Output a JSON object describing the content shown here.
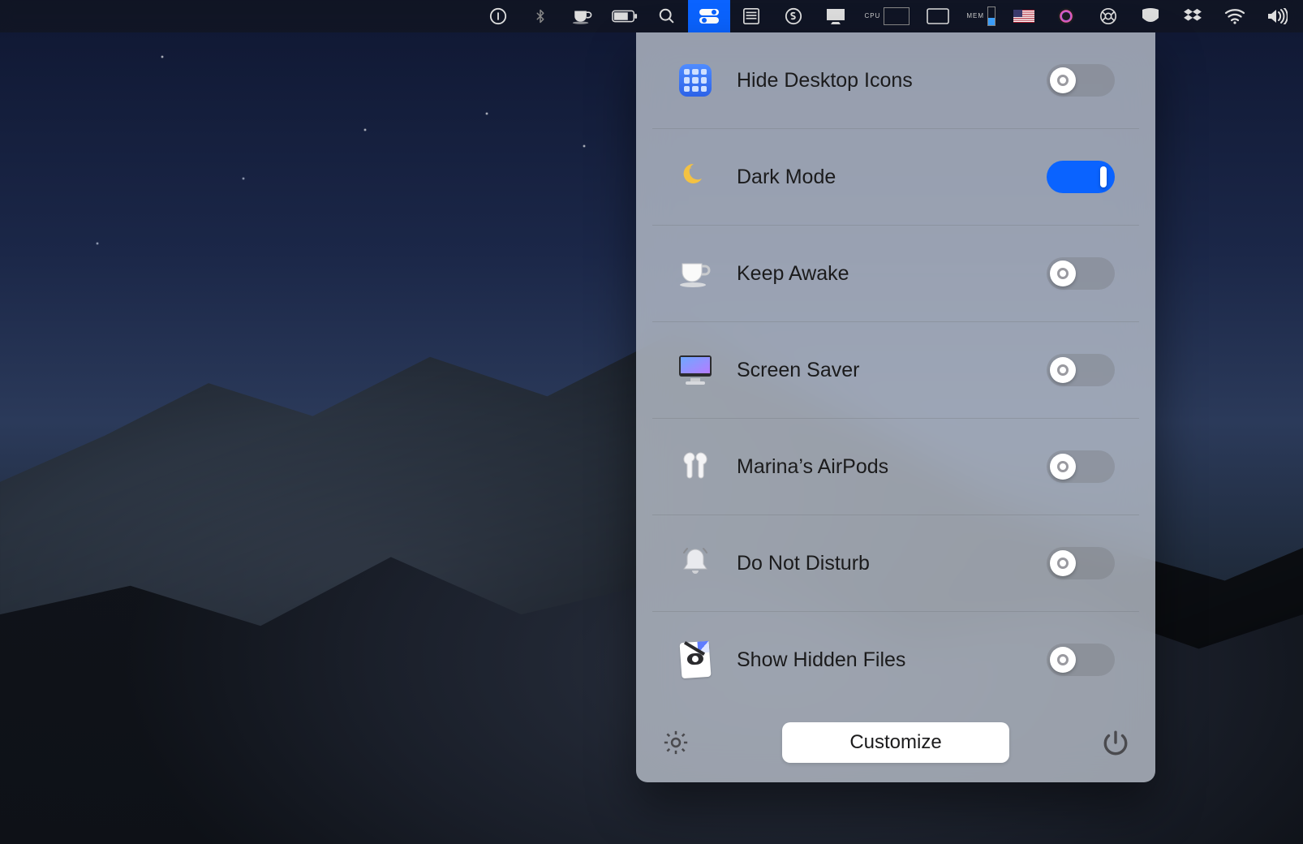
{
  "menubar": {
    "items": [
      {
        "name": "onepassword-icon"
      },
      {
        "name": "bluetooth-icon"
      },
      {
        "name": "caffeine-icon"
      },
      {
        "name": "battery-icon"
      },
      {
        "name": "spotlight-icon"
      },
      {
        "name": "control-center-icon",
        "selected": true
      },
      {
        "name": "disk-icon"
      },
      {
        "name": "skype-icon"
      },
      {
        "name": "display-icon"
      },
      {
        "name": "cpu-monitor-icon",
        "label": "CPU"
      },
      {
        "name": "activity-icon"
      },
      {
        "name": "memory-monitor-icon",
        "label": "MEM"
      },
      {
        "name": "input-source-us-icon"
      },
      {
        "name": "siri-icon"
      },
      {
        "name": "camera-settings-icon"
      },
      {
        "name": "vpn-icon"
      },
      {
        "name": "dropbox-icon"
      },
      {
        "name": "wifi-icon"
      },
      {
        "name": "volume-icon"
      }
    ]
  },
  "panel": {
    "items": [
      {
        "icon": "launchpad-icon",
        "label": "Hide Desktop Icons",
        "on": false
      },
      {
        "icon": "moon-icon",
        "label": "Dark Mode",
        "on": true
      },
      {
        "icon": "coffee-cup-icon",
        "label": "Keep Awake",
        "on": false
      },
      {
        "icon": "monitor-icon",
        "label": "Screen Saver",
        "on": false
      },
      {
        "icon": "airpods-icon",
        "label": "Marina’s AirPods",
        "on": false
      },
      {
        "icon": "bell-icon",
        "label": "Do Not Disturb",
        "on": false
      },
      {
        "icon": "hidden-file-icon",
        "label": "Show Hidden Files",
        "on": false
      }
    ],
    "footer": {
      "settings_icon": "gear-icon",
      "customize_label": "Customize",
      "power_icon": "power-icon"
    }
  }
}
